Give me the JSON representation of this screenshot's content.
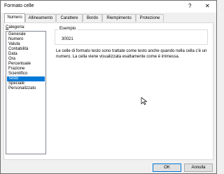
{
  "window": {
    "title": "Formato celle",
    "help_label": "?",
    "close_label": "✕"
  },
  "tabs": [
    {
      "label": "Numero",
      "active": true
    },
    {
      "label": "Allineamento",
      "active": false
    },
    {
      "label": "Carattere",
      "active": false
    },
    {
      "label": "Bordo",
      "active": false
    },
    {
      "label": "Riempimento",
      "active": false
    },
    {
      "label": "Protezione",
      "active": false
    }
  ],
  "category": {
    "label_accel": "C",
    "label_rest": "ategoria:",
    "items": [
      "Generale",
      "Numero",
      "Valuta",
      "Contabilità",
      "Data",
      "Ora",
      "Percentuale",
      "Frazione",
      "Scientifico",
      "Testo",
      "Speciale",
      "Personalizzato"
    ],
    "selected": "Testo"
  },
  "sample": {
    "legend": "Esempio",
    "value": "30021"
  },
  "description": "Le celle di formato testo sono trattate come testo anche quando nella cella c'è un numero. La cella viene visualizzata esattamente come è immessa.",
  "buttons": {
    "ok": "OK",
    "cancel": "Annulla"
  }
}
